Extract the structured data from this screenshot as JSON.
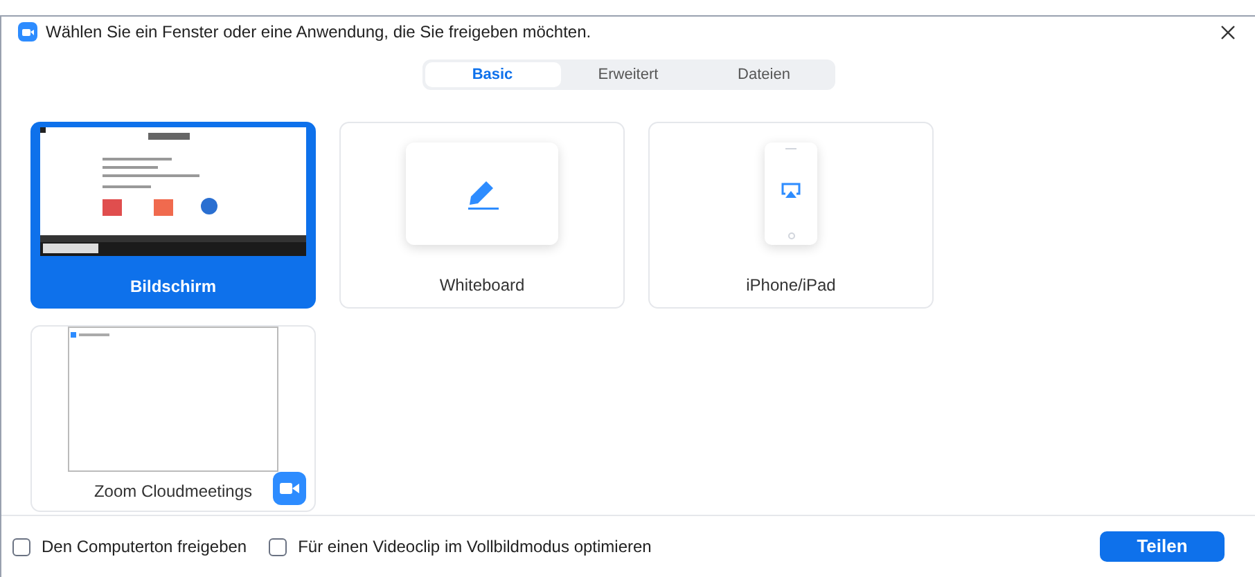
{
  "window": {
    "title": "Wählen Sie ein Fenster oder eine Anwendung, die Sie freigeben möchten."
  },
  "tabs": [
    {
      "label": "Basic",
      "selected": true
    },
    {
      "label": "Erweitert",
      "selected": false
    },
    {
      "label": "Dateien",
      "selected": false
    }
  ],
  "sources": [
    {
      "kind": "screen",
      "label": "Bildschirm",
      "selected": true
    },
    {
      "kind": "whiteboard",
      "label": "Whiteboard",
      "selected": false
    },
    {
      "kind": "device",
      "label": "iPhone/iPad",
      "selected": false
    },
    {
      "kind": "window",
      "label": "Zoom Cloudmeetings",
      "selected": false
    }
  ],
  "options": [
    {
      "label": "Den Computerton freigeben",
      "checked": false
    },
    {
      "label": "Für einen Videoclip im Vollbildmodus optimieren",
      "checked": false
    }
  ],
  "share_button": "Teilen"
}
